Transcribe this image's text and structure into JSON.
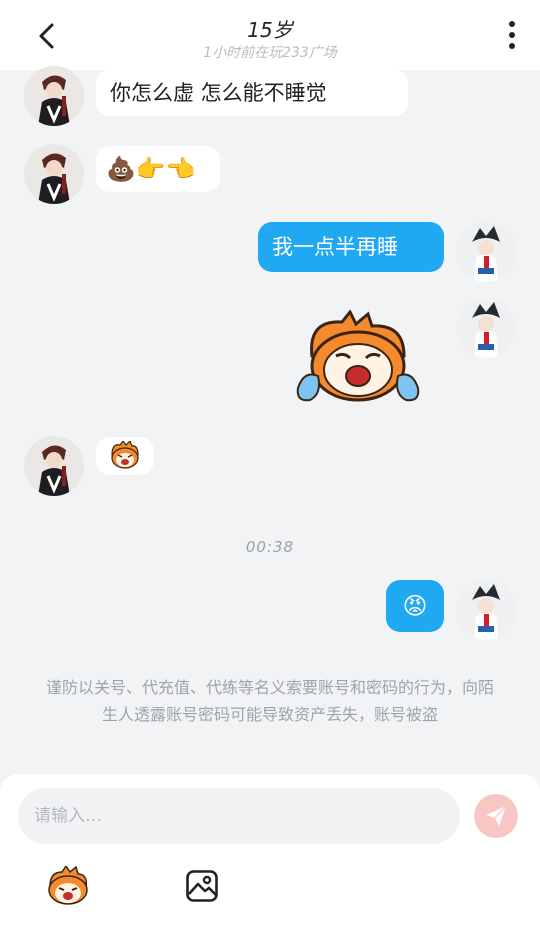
{
  "header": {
    "title": "15岁",
    "status": "1小时前在玩233广场"
  },
  "messages": [
    {
      "side": "in",
      "type": "text",
      "text": "你怎么虚 怎么能不睡觉"
    },
    {
      "side": "in",
      "type": "emoji",
      "text": "💩👉👈"
    },
    {
      "side": "out",
      "type": "text",
      "text": "我一点半再睡"
    },
    {
      "side": "out",
      "type": "sticker",
      "sticker": "crying-mascot-sticker"
    },
    {
      "side": "in",
      "type": "sticker",
      "sticker": "laughing-mascot-sticker"
    },
    {
      "side": "out",
      "type": "emoji",
      "text": "😡"
    }
  ],
  "timestamp": "00:38",
  "notice": "谨防以关号、代充值、代练等名义索要账号和密码的行为，向陌生人透露账号密码可能导致资产丢失，账号被盗",
  "composer": {
    "placeholder": "请输入…",
    "send_icon": "paper-plane-icon",
    "tools": [
      "mascot-emoji-icon",
      "image-icon"
    ]
  },
  "colors": {
    "outgoing_bubble": "#21a8f2",
    "incoming_bubble": "#ffffff",
    "send_button_disabled": "#f8c7c3",
    "background": "#f2f3f5"
  }
}
